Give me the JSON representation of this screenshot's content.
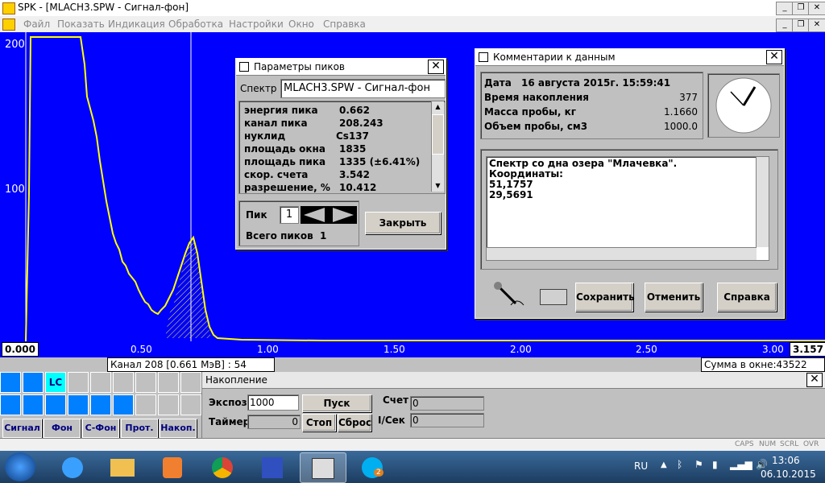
{
  "app": {
    "title": "SPK - [MLACH3.SPW - Сигнал-фон]"
  },
  "menu": [
    "Файл",
    "Показать",
    "Индикация",
    "Обработка",
    "Настройки",
    "Окно",
    "Справка"
  ],
  "plot": {
    "y_labels": [
      "200",
      "100"
    ],
    "x_min": "0.000",
    "x_max": "3.157",
    "x_ticks": [
      "0.50",
      "1.00",
      "1.50",
      "2.00",
      "2.50",
      "3.00"
    ],
    "channel_info": "Канал 208 [0.661  МэВ] : 54",
    "window_sum": "Сумма в окне:43522",
    "colors": {
      "background": "#0000ff",
      "spectrum": "#ffff00",
      "cursor": "#ffffff"
    }
  },
  "peaks": {
    "title": "Параметры пиков",
    "spectrum_label": "Спектр",
    "spectrum_value": "MLACH3.SPW - Сигнал-фон",
    "rows": [
      {
        "label": "энергия пика",
        "value": "0.662"
      },
      {
        "label": "канал пика",
        "value": "208.243"
      },
      {
        "label": "нуклид",
        "value": "Cs137"
      },
      {
        "label": "площадь окна",
        "value": "1835"
      },
      {
        "label": "площадь пика",
        "value": "1335 (±6.41%)"
      },
      {
        "label": "скор. счета",
        "value": "3.542"
      },
      {
        "label": "разрешение, %",
        "value": "10.412"
      }
    ],
    "peak_label": "Пик",
    "peak_number": "1",
    "total_label": "Всего пиков",
    "total_value": "1",
    "close": "Закрыть"
  },
  "comments": {
    "title": "Комментарии к данным",
    "date_label": "Дата",
    "date_value": "16 августа  2015г. 15:59:41",
    "acq_label": "Время накопления",
    "acq_value": "377",
    "mass_label": "Масса пробы, кг",
    "mass_value": "1.1660",
    "volume_label": "Объем пробы, см3",
    "volume_value": "1000.0",
    "text_lines": [
      "Спектр со дна озера \"Млачевка\".",
      "Координаты:",
      "51,1757",
      "29,5691"
    ],
    "save": "Сохранить",
    "cancel": "Отменить",
    "help": "Справка"
  },
  "accum": {
    "title": "Накопление",
    "expos_label": "Экспоз",
    "expos_value": "1000",
    "timer_label": "Таймер",
    "timer_value": "0",
    "start": "Пуск",
    "stop": "Стоп",
    "reset": "Сброс",
    "count_label": "Счет",
    "count_value": "0",
    "rate_label": "I/Сек",
    "rate_value": "0"
  },
  "modes": [
    "Сигнал",
    "Фон",
    "С-Фон",
    "Прот.",
    "Накоп."
  ],
  "lc_label": "LC",
  "status": [
    "CAPS",
    "NUM",
    "SCRL",
    "OVR"
  ],
  "taskbar": {
    "lang": "RU",
    "time": "13:06",
    "date": "06.10.2015",
    "skype_badge": "2"
  }
}
